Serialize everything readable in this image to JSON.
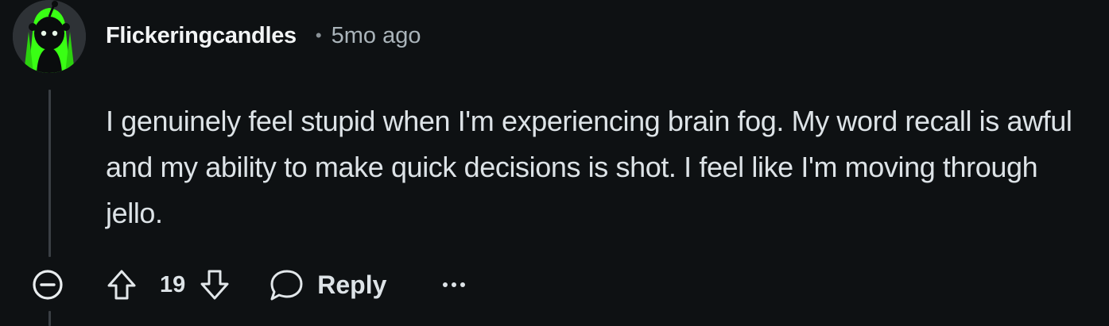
{
  "comment": {
    "author": "Flickeringcandles",
    "separator": "•",
    "time": "5mo ago",
    "body": "I genuinely feel stupid when I'm experiencing brain fog. My word recall is awful and my ability to make quick decisions is shot. I feel like I'm moving through jello.",
    "score": "19",
    "reply_label": "Reply"
  },
  "icons": {
    "avatar": "avatar-green-snoo",
    "collapse": "minus-circle-icon",
    "upvote": "arrow-up-icon",
    "downvote": "arrow-down-icon",
    "reply": "speech-bubble-icon",
    "more": "ellipsis-icon"
  },
  "colors": {
    "background": "#0e1113",
    "text_primary": "#f2f4f5",
    "text_body": "#dde3e7",
    "text_meta": "#aab4ba",
    "avatar_accent": "#39ff14"
  }
}
